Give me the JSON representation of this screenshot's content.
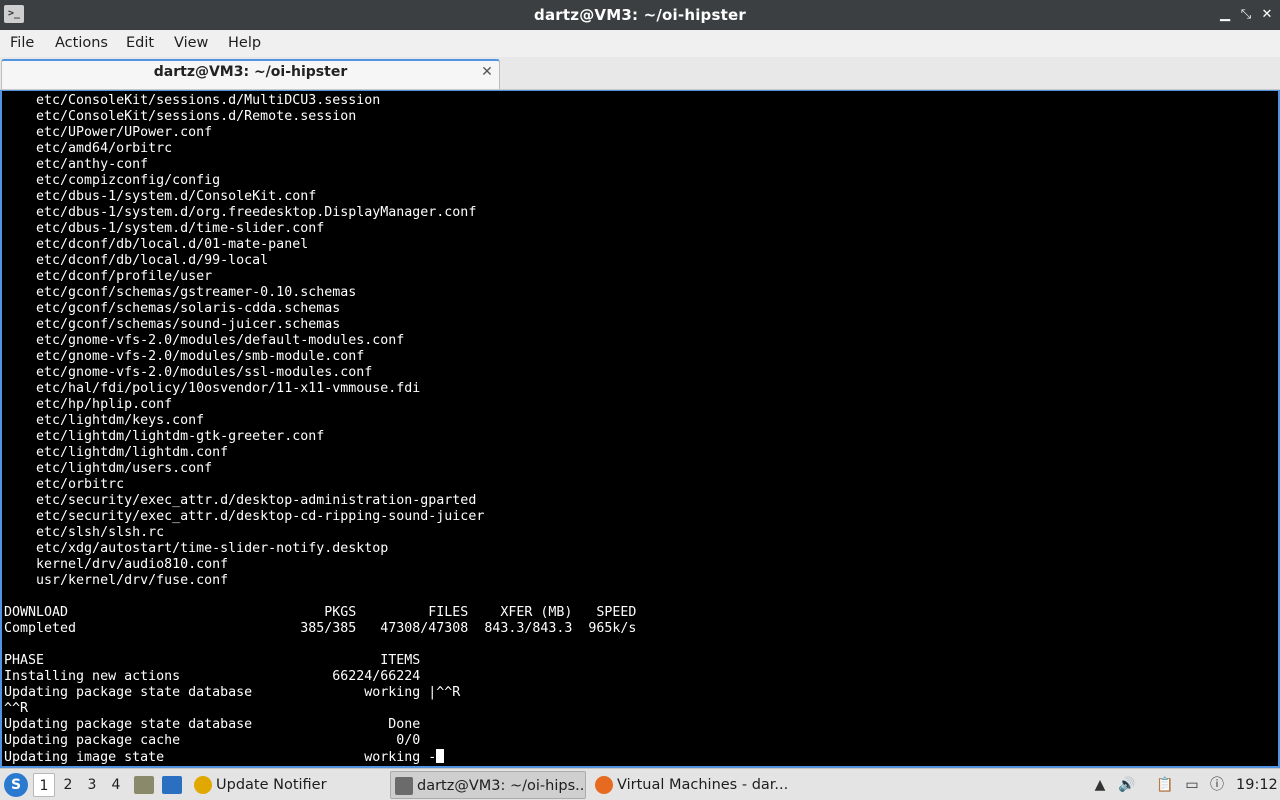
{
  "window": {
    "title": "dartz@VM3: ~/oi-hipster",
    "app_icon_glyph": ">_",
    "controls": {
      "minimize": "▁",
      "maximize": "⤡",
      "close": "✕"
    }
  },
  "menubar": {
    "items": [
      "File",
      "Actions",
      "Edit",
      "View",
      "Help"
    ]
  },
  "tab": {
    "label": "dartz@VM3: ~/oi-hipster",
    "close": "✕"
  },
  "terminal": {
    "lines": [
      "    etc/ConsoleKit/sessions.d/MultiDCU3.session",
      "    etc/ConsoleKit/sessions.d/Remote.session",
      "    etc/UPower/UPower.conf",
      "    etc/amd64/orbitrc",
      "    etc/anthy-conf",
      "    etc/compizconfig/config",
      "    etc/dbus-1/system.d/ConsoleKit.conf",
      "    etc/dbus-1/system.d/org.freedesktop.DisplayManager.conf",
      "    etc/dbus-1/system.d/time-slider.conf",
      "    etc/dconf/db/local.d/01-mate-panel",
      "    etc/dconf/db/local.d/99-local",
      "    etc/dconf/profile/user",
      "    etc/gconf/schemas/gstreamer-0.10.schemas",
      "    etc/gconf/schemas/solaris-cdda.schemas",
      "    etc/gconf/schemas/sound-juicer.schemas",
      "    etc/gnome-vfs-2.0/modules/default-modules.conf",
      "    etc/gnome-vfs-2.0/modules/smb-module.conf",
      "    etc/gnome-vfs-2.0/modules/ssl-modules.conf",
      "    etc/hal/fdi/policy/10osvendor/11-x11-vmmouse.fdi",
      "    etc/hp/hplip.conf",
      "    etc/lightdm/keys.conf",
      "    etc/lightdm/lightdm-gtk-greeter.conf",
      "    etc/lightdm/lightdm.conf",
      "    etc/lightdm/users.conf",
      "    etc/orbitrc",
      "    etc/security/exec_attr.d/desktop-administration-gparted",
      "    etc/security/exec_attr.d/desktop-cd-ripping-sound-juicer",
      "    etc/slsh/slsh.rc",
      "    etc/xdg/autostart/time-slider-notify.desktop",
      "    kernel/drv/audio810.conf",
      "    usr/kernel/drv/fuse.conf",
      "",
      "DOWNLOAD                                PKGS         FILES    XFER (MB)   SPEED",
      "Completed                            385/385   47308/47308  843.3/843.3  965k/s",
      "",
      "PHASE                                          ITEMS",
      "Installing new actions                   66224/66224",
      "Updating package state database              working |^^R",
      "^^R",
      "Updating package state database                 Done",
      "Updating package cache                           0/0",
      "Updating image state                         working -"
    ]
  },
  "taskbar": {
    "start_label": "S",
    "desktops": [
      "1",
      "2",
      "3",
      "4"
    ],
    "active_desktop": "1",
    "tasks": [
      {
        "label": "Update Notifier",
        "icon": "update-notifier-icon"
      },
      {
        "label": "dartz@VM3: ~/oi-hips...",
        "icon": "terminal-icon"
      },
      {
        "label": "Virtual Machines - dar...",
        "icon": "firefox-icon"
      }
    ],
    "clock": "19:12"
  },
  "colors": {
    "accent": "#5294e2",
    "terminal_bg": "#000000",
    "terminal_fg": "#ffffff"
  }
}
